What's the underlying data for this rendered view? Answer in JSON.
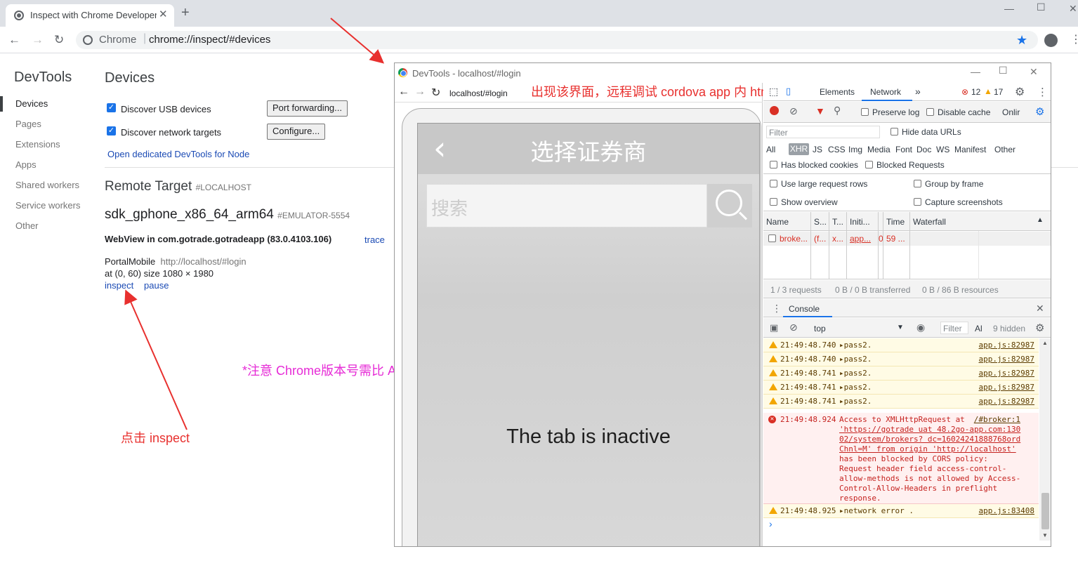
{
  "browser": {
    "tab_title": "Inspect with Chrome Developer Tools",
    "omnibox_scheme": "Chrome",
    "omnibox_url": "chrome://inspect/#devices"
  },
  "inspect_page": {
    "heading": "DevTools",
    "sidebar": [
      "Devices",
      "Pages",
      "Extensions",
      "Apps",
      "Shared workers",
      "Service workers",
      "Other"
    ],
    "main_title": "Devices",
    "discover_usb": "Discover USB devices",
    "port_forwarding": "Port forwarding...",
    "discover_network": "Discover network targets",
    "configure": "Configure...",
    "node_link": "Open dedicated DevTools for Node",
    "remote_target": "Remote Target",
    "remote_target_tag": "#LOCALHOST",
    "device_name": "sdk_gphone_x86_64_arm64",
    "device_tag": "#EMULATOR-5554",
    "webview": "WebView in com.gotrade.gotradeapp (83.0.4103.106)",
    "trace": "trace",
    "page_name": "PortalMobile",
    "page_url": "http://localhost/#login",
    "page_geom": "at (0, 60)  size 1080 × 1980",
    "inspect": "inspect",
    "pause": "pause"
  },
  "annotations": {
    "top": "出现该界面，远程调试 cordova app 内 html",
    "middle": "*注意 Chrome版本号需比 Android webview 内核新或相等",
    "bottom": "点击 inspect"
  },
  "devtools": {
    "window_title": "DevTools - localhost/#login",
    "screencast_url": "localhost/#login",
    "app_title": "选择证券商",
    "search_placeholder": "搜索",
    "inactive": "The tab is inactive",
    "tabs": [
      "Elements",
      "Network"
    ],
    "more_tabs": "»",
    "errors": "12",
    "warnings": "17",
    "preserve_log": "Preserve log",
    "disable_cache": "Disable cache",
    "online": "Onlir",
    "filter_placeholder": "Filter",
    "hide_data_urls": "Hide data URLs",
    "type_filters": [
      "All",
      "XHR",
      "JS",
      "CSS",
      "Img",
      "Media",
      "Font",
      "Doc",
      "WS",
      "Manifest",
      "Other"
    ],
    "has_blocked_cookies": "Has blocked cookies",
    "blocked_requests": "Blocked Requests",
    "large_rows": "Use large request rows",
    "group_by_frame": "Group by frame",
    "show_overview": "Show overview",
    "capture_screenshots": "Capture screenshots",
    "columns": [
      "Name",
      "S...",
      "T...",
      "Initi...",
      "Time",
      "Waterfall"
    ],
    "row": [
      "broke...",
      "(f...",
      "x...",
      "app...",
      "0",
      "59 ..."
    ],
    "status_requests": "1 / 3 requests",
    "status_transferred": "0 B / 0 B transferred",
    "status_resources": "0 B / 86 B resources",
    "console_tab": "Console",
    "context": "top",
    "console_filter": "Filter",
    "levels": "Al",
    "hidden": "9 hidden",
    "warn_lines": [
      {
        "time": "21:49:48.740",
        "msg": "▸pass2.",
        "src": "app.js:82987"
      },
      {
        "time": "21:49:48.740",
        "msg": "▸pass2.",
        "src": "app.js:82987"
      },
      {
        "time": "21:49:48.741",
        "msg": "▸pass2.",
        "src": "app.js:82987"
      },
      {
        "time": "21:49:48.741",
        "msg": "▸pass2.",
        "src": "app.js:82987"
      },
      {
        "time": "21:49:48.741",
        "msg": "▸pass2.",
        "src": "app.js:82987"
      }
    ],
    "error": {
      "time": "21:49:48.924",
      "prefix": "Access to XMLHttpRequest at",
      "src": "/#broker:1",
      "lines": [
        "'https://gotrade uat 48.2go-app.com:130",
        "02/system/brokers? dc=16024241888768ord",
        "Chnl=M' from origin 'http://localhost'",
        "has been blocked by CORS policy:",
        "Request header field access-control-",
        "allow-methods is not allowed by Access-",
        "Control-Allow-Headers in preflight",
        "response."
      ]
    },
    "last_warn": {
      "time": "21:49:48.925",
      "msg": "▸network error .",
      "src": "app.js:83408"
    },
    "prompt": "›"
  }
}
